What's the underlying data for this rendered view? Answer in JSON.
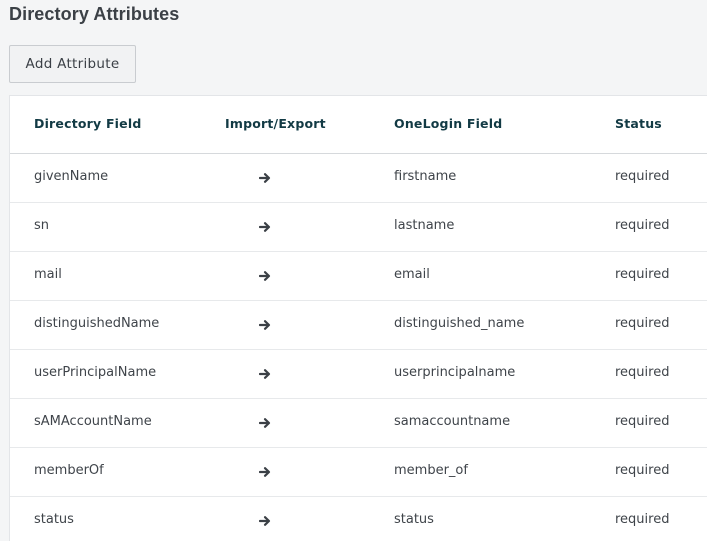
{
  "page": {
    "title": "Directory Attributes"
  },
  "toolbar": {
    "add_label": "Add Attribute"
  },
  "table": {
    "headers": {
      "directory_field": "Directory Field",
      "import_export": "Import/Export",
      "onelogin_field": "OneLogin Field",
      "status": "Status"
    },
    "arrow_icon": "arrow-right-icon",
    "rows": [
      {
        "directory": "givenName",
        "onelogin": "firstname",
        "status": "required"
      },
      {
        "directory": "sn",
        "onelogin": "lastname",
        "status": "required"
      },
      {
        "directory": "mail",
        "onelogin": "email",
        "status": "required"
      },
      {
        "directory": "distinguishedName",
        "onelogin": "distinguished_name",
        "status": "required"
      },
      {
        "directory": "userPrincipalName",
        "onelogin": "userprincipalname",
        "status": "required"
      },
      {
        "directory": "sAMAccountName",
        "onelogin": "samaccountname",
        "status": "required"
      },
      {
        "directory": "memberOf",
        "onelogin": "member_of",
        "status": "required"
      },
      {
        "directory": "status",
        "onelogin": "status",
        "status": "required"
      }
    ]
  },
  "colors": {
    "header_text": "#123a44",
    "body_text": "#3f444a",
    "arrow": "#3b4046"
  }
}
